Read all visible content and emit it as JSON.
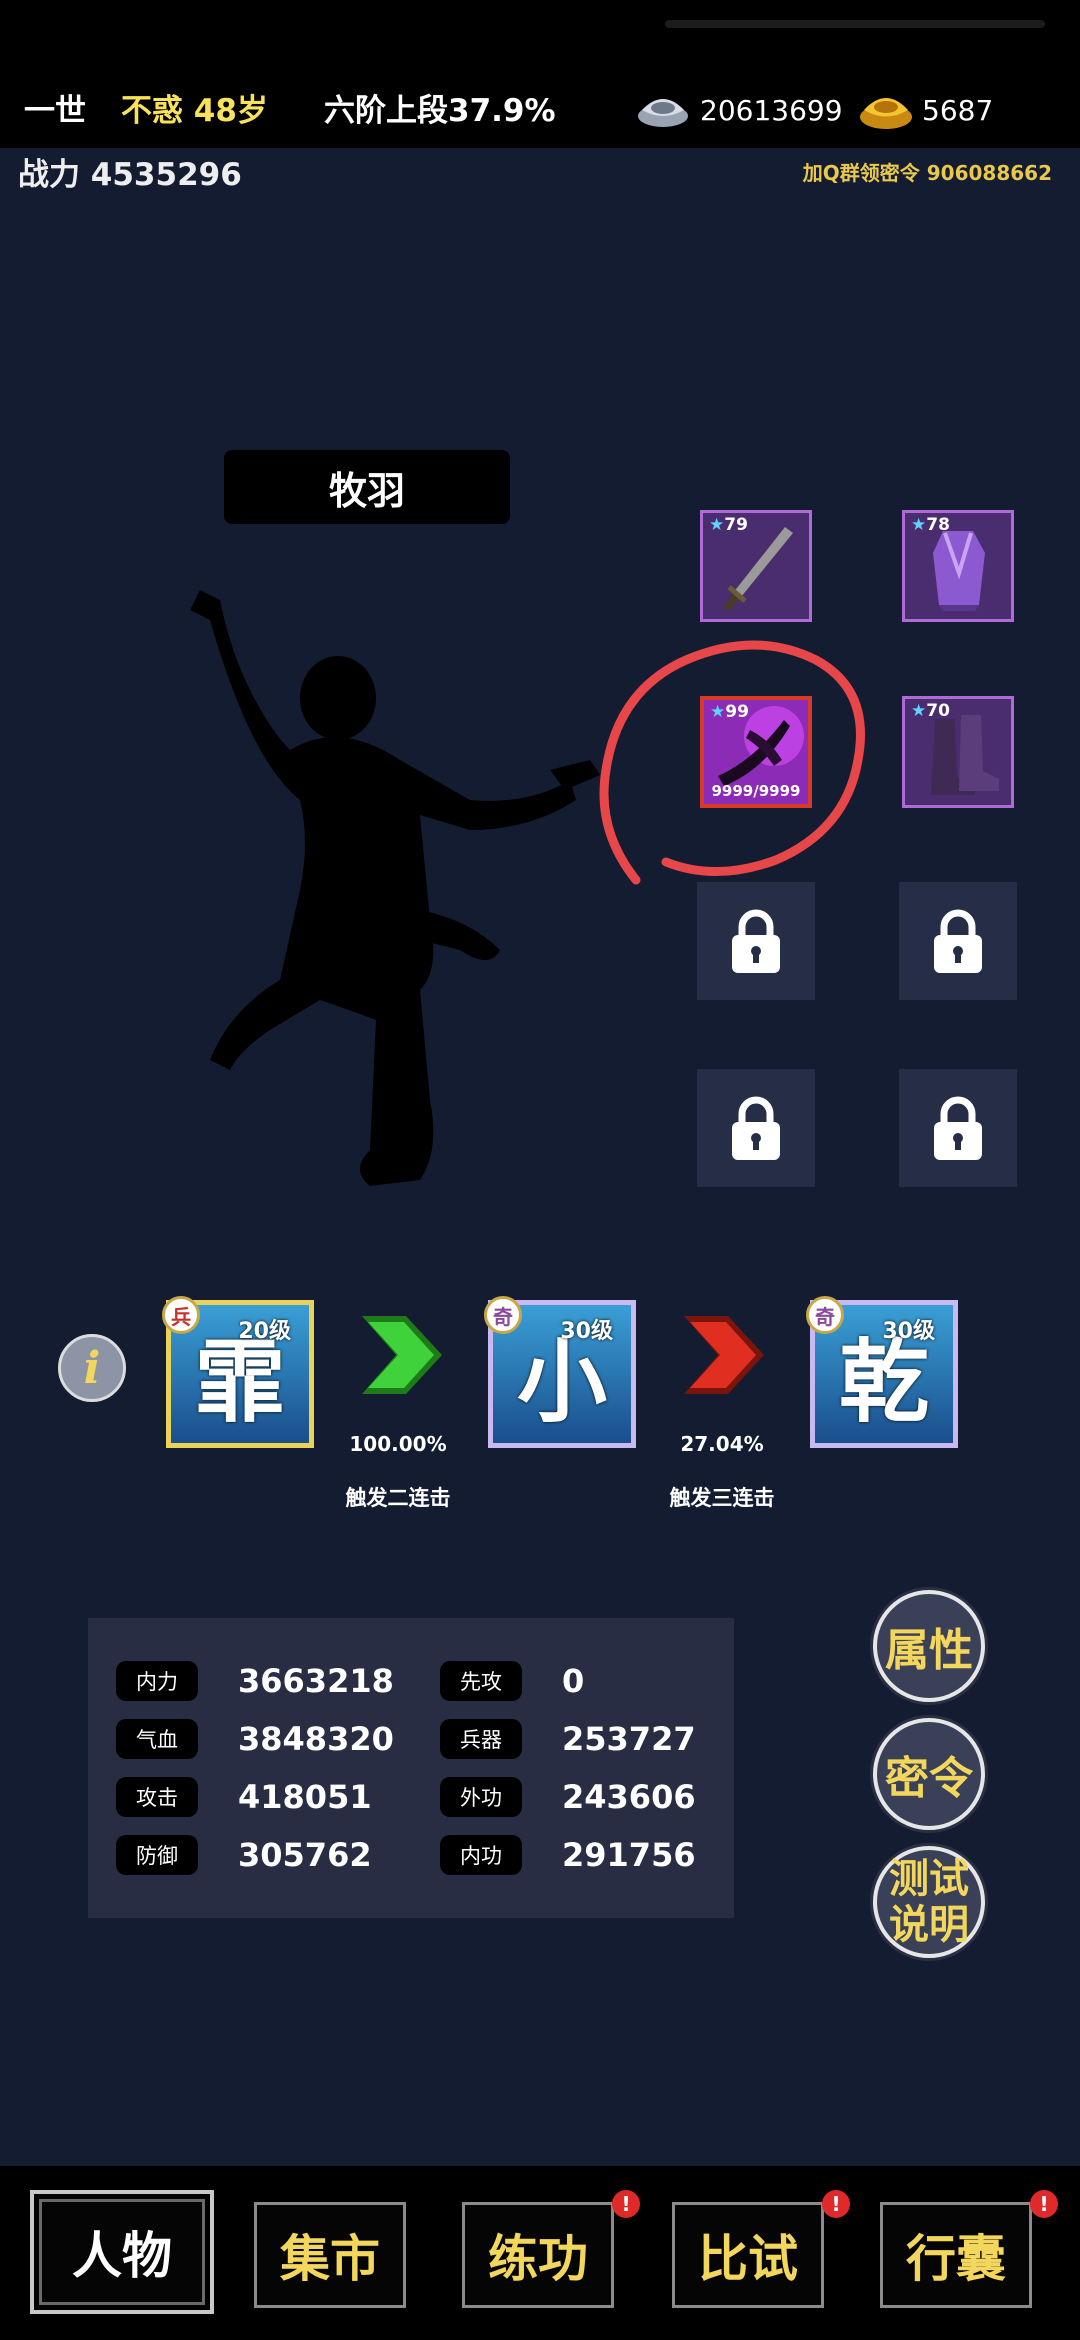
{
  "header": {
    "generation": "一世",
    "age": "不惑 48岁",
    "realm": "六阶上段37.9%",
    "silver": "20613699",
    "gold": "5687",
    "power": "战力 4535296",
    "promo": "加Q群领密令 906088662"
  },
  "character": {
    "name": "牧羽"
  },
  "equipment": [
    {
      "level": "79",
      "icon": "sword-icon"
    },
    {
      "level": "78",
      "icon": "robe-icon"
    },
    {
      "level": "99",
      "icon": "glowing-weapon-icon",
      "durability": "9999/9999"
    },
    {
      "level": "70",
      "icon": "boots-icon"
    }
  ],
  "skills": [
    {
      "glyph": "霏",
      "level": "20级",
      "badge": "兵"
    },
    {
      "glyph": "小",
      "level": "30级",
      "badge": "奇"
    },
    {
      "glyph": "乾",
      "level": "30级",
      "badge": "奇"
    }
  ],
  "chain": [
    {
      "percent": "100.00%",
      "label": "触发二连击",
      "color": "#3fd23a"
    },
    {
      "percent": "27.04%",
      "label": "触发三连击",
      "color": "#e02f20"
    }
  ],
  "stats": [
    {
      "label": "内力",
      "value": "3663218"
    },
    {
      "label": "先攻",
      "value": "0"
    },
    {
      "label": "气血",
      "value": "3848320"
    },
    {
      "label": "兵器",
      "value": "253727"
    },
    {
      "label": "攻击",
      "value": "418051"
    },
    {
      "label": "外功",
      "value": "243606"
    },
    {
      "label": "防御",
      "value": "305762"
    },
    {
      "label": "内功",
      "value": "291756"
    }
  ],
  "side_buttons": {
    "attributes": "属性",
    "code": "密令",
    "test_line1": "测试",
    "test_line2": "说明"
  },
  "nav": [
    {
      "label": "人物",
      "active": true,
      "badge": ""
    },
    {
      "label": "集市",
      "active": false,
      "badge": ""
    },
    {
      "label": "练功",
      "active": false,
      "badge": "!"
    },
    {
      "label": "比试",
      "active": false,
      "badge": "!"
    },
    {
      "label": "行囊",
      "active": false,
      "badge": "!"
    }
  ]
}
